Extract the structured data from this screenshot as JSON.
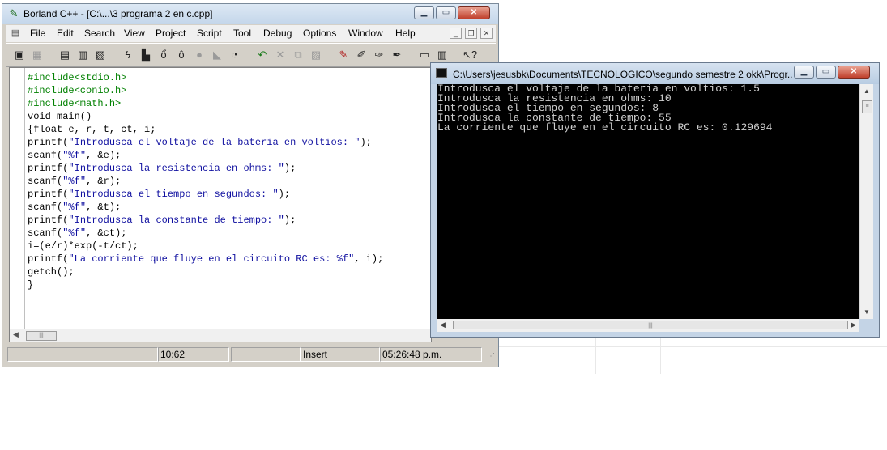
{
  "borland": {
    "title": "Borland C++ - [C:\\...\\3 programa 2 en c.cpp]",
    "menu": [
      "File",
      "Edit",
      "Search",
      "View",
      "Project",
      "Script",
      "Tool",
      "Debug",
      "Options",
      "Window",
      "Help"
    ],
    "toolbar_icons": [
      "new-project-icon",
      "open-project-icon",
      "new-file-icon",
      "open-file-icon",
      "save-file-icon",
      "lightning-icon",
      "compile-icon",
      "run-icon",
      "debug-icon",
      "stop-icon",
      "step-icon",
      "breakpoint-icon",
      "undo-icon",
      "cut-icon",
      "copy-icon",
      "paste-icon",
      "pen-icon",
      "browse-icon",
      "inspect-icon",
      "view-icon",
      "window-icon",
      "help-cursor-icon"
    ],
    "code_lines": [
      [
        {
          "t": "#include<stdio.h>",
          "c": "pp"
        }
      ],
      [
        {
          "t": "#include<conio.h>",
          "c": "pp"
        }
      ],
      [
        {
          "t": "#include<math.h>",
          "c": "pp"
        }
      ],
      [
        {
          "t": "void main()",
          "c": "kw"
        }
      ],
      [
        {
          "t": "{float e, r, t, ct, i;",
          "c": "kw"
        }
      ],
      [
        {
          "t": "printf(",
          "c": "kw"
        },
        {
          "t": "\"Introdusca el voltaje de la bateria en voltios: \"",
          "c": "str"
        },
        {
          "t": ");",
          "c": "kw"
        }
      ],
      [
        {
          "t": "scanf(",
          "c": "kw"
        },
        {
          "t": "\"%f\"",
          "c": "str"
        },
        {
          "t": ", &e);",
          "c": "kw"
        }
      ],
      [
        {
          "t": "printf(",
          "c": "kw"
        },
        {
          "t": "\"Introdusca la resistencia en ohms: \"",
          "c": "str"
        },
        {
          "t": ");",
          "c": "kw"
        }
      ],
      [
        {
          "t": "scanf(",
          "c": "kw"
        },
        {
          "t": "\"%f\"",
          "c": "str"
        },
        {
          "t": ", &r);",
          "c": "kw"
        }
      ],
      [
        {
          "t": "printf(",
          "c": "kw"
        },
        {
          "t": "\"Introdusca el tiempo en segundos: \"",
          "c": "str"
        },
        {
          "t": ");",
          "c": "kw"
        }
      ],
      [
        {
          "t": "scanf(",
          "c": "kw"
        },
        {
          "t": "\"%f\"",
          "c": "str"
        },
        {
          "t": ", &t);",
          "c": "kw"
        }
      ],
      [
        {
          "t": "printf(",
          "c": "kw"
        },
        {
          "t": "\"Introdusca la constante de tiempo: \"",
          "c": "str"
        },
        {
          "t": ");",
          "c": "kw"
        }
      ],
      [
        {
          "t": "scanf(",
          "c": "kw"
        },
        {
          "t": "\"%f\"",
          "c": "str"
        },
        {
          "t": ", &ct);",
          "c": "kw"
        }
      ],
      [
        {
          "t": "i=(e/r)*exp(-t/ct);",
          "c": "kw"
        }
      ],
      [
        {
          "t": "printf(",
          "c": "kw"
        },
        {
          "t": "\"La corriente que fluye en el circuito RC es: %f\"",
          "c": "str"
        },
        {
          "t": ", i);",
          "c": "kw"
        }
      ],
      [
        {
          "t": "getch();",
          "c": "kw"
        }
      ],
      [
        {
          "t": "}",
          "c": "kw"
        }
      ]
    ],
    "status": {
      "position": "10:62",
      "mode": "Insert",
      "time": "05:26:48 p.m."
    }
  },
  "console": {
    "title": "C:\\Users\\jesusbk\\Documents\\TECNOLOGICO\\segundo semestre 2 okk\\Progr...",
    "output_lines": [
      "Introdusca el voltaje de la bateria en voltios: 1.5",
      "Introdusca la resistencia en ohms: 10",
      "Introdusca el tiempo en segundos: 8",
      "Introdusca la constante de tiempo: 55",
      "La corriente que fluye en el circuito RC es: 0.129694"
    ]
  }
}
